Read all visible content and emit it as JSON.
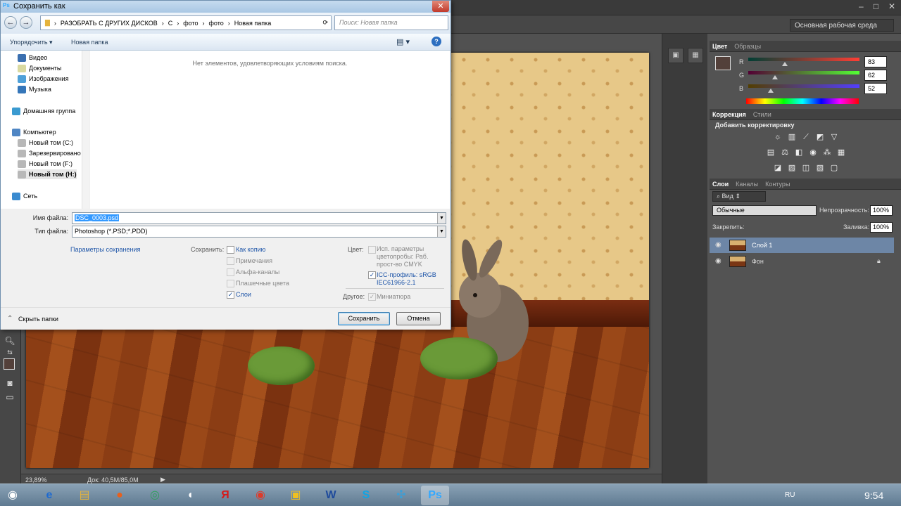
{
  "photoshop": {
    "workspace": "Основная рабочая среда",
    "zoom": "23,89%",
    "doc_info": "Док: 40,5M/85,0M",
    "color_panel": {
      "tabs": [
        "Цвет",
        "Образцы"
      ],
      "sliders": [
        {
          "label": "R",
          "value": "83",
          "fraction": 0.33
        },
        {
          "label": "G",
          "value": "62",
          "fraction": 0.24
        },
        {
          "label": "B",
          "value": "52",
          "fraction": 0.2
        }
      ],
      "foreground": "#53403a"
    },
    "adjustments_panel": {
      "tabs": [
        "Коррекция",
        "Стили"
      ],
      "heading": "Добавить корректировку"
    },
    "layers_panel": {
      "tabs": [
        "Слои",
        "Каналы",
        "Контуры"
      ],
      "filter": "Вид",
      "blend_mode": "Обычные",
      "opacity_label": "Непрозрачность:",
      "opacity": "100%",
      "lock_label": "Закрепить:",
      "fill_label": "Заливка:",
      "fill": "100%",
      "layers": [
        {
          "name": "Слой 1",
          "selected": true
        },
        {
          "name": "Фон",
          "selected": false
        }
      ]
    }
  },
  "dialog": {
    "title": "Сохранить как",
    "breadcrumbs": [
      "РАЗОБРАТЬ С ДРУГИХ ДИСКОВ",
      "С",
      "фото",
      "фото",
      "Новая папка"
    ],
    "search_placeholder": "Поиск: Новая папка",
    "organize": "Упорядочить ▾",
    "new_folder": "Новая папка",
    "empty_message": "Нет элементов, удовлетворяющих условиям поиска.",
    "nav": [
      {
        "label": "Видео",
        "bold": false
      },
      {
        "label": "Документы",
        "bold": false
      },
      {
        "label": "Изображения",
        "bold": false
      },
      {
        "label": "Музыка",
        "bold": false
      },
      {
        "label": "Домашняя группа",
        "bold": false
      },
      {
        "label": "Компьютер",
        "bold": false
      },
      {
        "label": "Новый том (C:)",
        "bold": false
      },
      {
        "label": "Зарезервировано",
        "bold": false
      },
      {
        "label": "Новый том (F:)",
        "bold": false
      },
      {
        "label": "Новый том (H:)",
        "bold": true
      },
      {
        "label": "Сеть",
        "bold": false
      }
    ],
    "filename_label": "Имя файла:",
    "filename": "DSC_0003.psd",
    "filetype_label": "Тип файла:",
    "filetype": "Photoshop (*.PSD;*.PDD)",
    "save_params": "Параметры сохранения",
    "save_label": "Сохранить:",
    "save_options": [
      {
        "label": "Как копию",
        "checked": false,
        "enabled": true
      },
      {
        "label": "Примечания",
        "checked": false,
        "enabled": false
      },
      {
        "label": "Альфа-каналы",
        "checked": false,
        "enabled": false
      },
      {
        "label": "Плашечные цвета",
        "checked": false,
        "enabled": false
      },
      {
        "label": "Слои",
        "checked": true,
        "enabled": true
      }
    ],
    "color_label": "Цвет:",
    "proof_option": "Исп. параметры цветопробы: Раб. прост-во CMYK",
    "icc_option": "ICC-профиль: sRGB IEC61966-2.1",
    "other_label": "Другое:",
    "thumbnail_option": "Миниатюра",
    "hide_folders": "Скрыть папки",
    "save_button": "Сохранить",
    "cancel_button": "Отмена"
  },
  "taskbar": {
    "lang": "RU",
    "time": "9:54"
  }
}
